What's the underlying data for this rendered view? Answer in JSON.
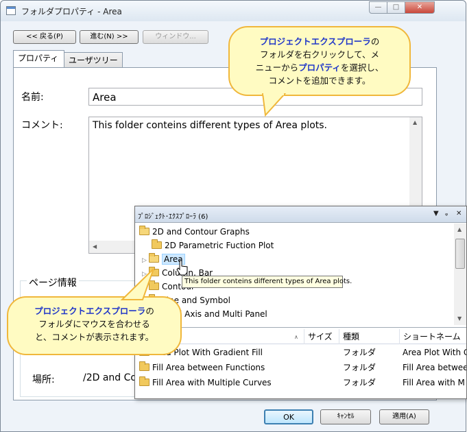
{
  "window": {
    "title": "フォルダプロパティ - Area",
    "min_glyph": "—",
    "max_glyph": "□",
    "close_glyph": "✕"
  },
  "toolbar": {
    "back_label": "<< 戻る(P)",
    "forward_label": "進む(N) >>",
    "window_label": "ウィンドウ..."
  },
  "tabs": [
    {
      "label": "プロパティ"
    },
    {
      "label": "ユーザツリー"
    }
  ],
  "properties": {
    "name_label": "名前:",
    "name_value": "Area",
    "comment_label": "コメント:",
    "comment_value": "This folder conteins different types of Area plots.",
    "page_info_label": "ページ情報",
    "location_label": "場所:",
    "location_value": "/2D and Co"
  },
  "dialog_buttons": {
    "ok": "OK",
    "cancel": "ｷｬﾝｾﾙ",
    "apply": "適用(A)"
  },
  "project_explorer": {
    "title": "ﾌﾟﾛｼﾞｪｸﾄ･ｴｸｽﾌﾟﾛｰﾗ (6)",
    "ctrl_dropdown": "▼",
    "ctrl_pin": "ᵩ",
    "ctrl_close": "✕",
    "tree": [
      {
        "label": "2D and Contour Graphs"
      },
      {
        "label": "2D Parametric Fuction Plot"
      },
      {
        "label": "Area"
      },
      {
        "label": "Column, Bar"
      },
      {
        "label": "Contour"
      },
      {
        "label": "Line and Symbol"
      },
      {
        "label": "Multi Axis and Multi Panel"
      }
    ],
    "tooltip": "This folder conteins different types of Area plots.",
    "columns": [
      "サイズ",
      "種類",
      "ショートネーム"
    ],
    "rows": [
      {
        "name": "Area Plot With Gradient Fill",
        "type": "フォルダ",
        "short": "Area Plot With G"
      },
      {
        "name": "Fill Area between Functions",
        "type": "フォルダ",
        "short": "Fill Area betwee"
      },
      {
        "name": "Fill Area with Multiple Curves",
        "type": "フォルダ",
        "short": "Fill Area with M"
      }
    ]
  },
  "callouts": {
    "top": {
      "line1": "プロジェクトエクスプローラ",
      "line1_suffix": "の",
      "line2": "フォルダを右クリックして、メ",
      "line3_pre": "ニューから",
      "line3_bold": "プロパティ",
      "line3_post": "を選択し、",
      "line4": "コメントを追加できます。"
    },
    "bottom": {
      "line1": "プロジェクトエクスプローラ",
      "line1_suffix": "の",
      "line2": "フォルダにマウスを合わせる",
      "line3": "と、コメントが表示されます。"
    }
  },
  "colors": {
    "callout_fill": "#fffbc2",
    "callout_border": "#f0b73b",
    "callout_emphasis": "#1f36c8",
    "tooltip_fill": "#ffffe1"
  }
}
